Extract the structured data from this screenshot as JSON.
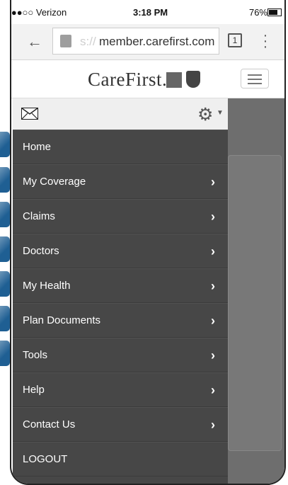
{
  "status_bar": {
    "carrier": "●●●○○ Verizon",
    "time": "3:18 PM",
    "battery": "76%"
  },
  "browser": {
    "url_prefix": "s://",
    "url": "member.carefirst.com",
    "tab_count": "1"
  },
  "header": {
    "logo_text": "CareFirst."
  },
  "menu": {
    "items": [
      {
        "label": "Home",
        "has_arrow": false
      },
      {
        "label": "My Coverage",
        "has_arrow": true
      },
      {
        "label": "Claims",
        "has_arrow": true
      },
      {
        "label": "Doctors",
        "has_arrow": true
      },
      {
        "label": "My Health",
        "has_arrow": true
      },
      {
        "label": "Plan Documents",
        "has_arrow": true
      },
      {
        "label": "Tools",
        "has_arrow": true
      },
      {
        "label": "Help",
        "has_arrow": true
      },
      {
        "label": "Contact Us",
        "has_arrow": true
      },
      {
        "label": "LOGOUT",
        "has_arrow": false
      }
    ],
    "arrow_glyph": "›"
  },
  "colors": {
    "menu_bg": "#474747",
    "side_tab_blue": "#1f5f93"
  }
}
